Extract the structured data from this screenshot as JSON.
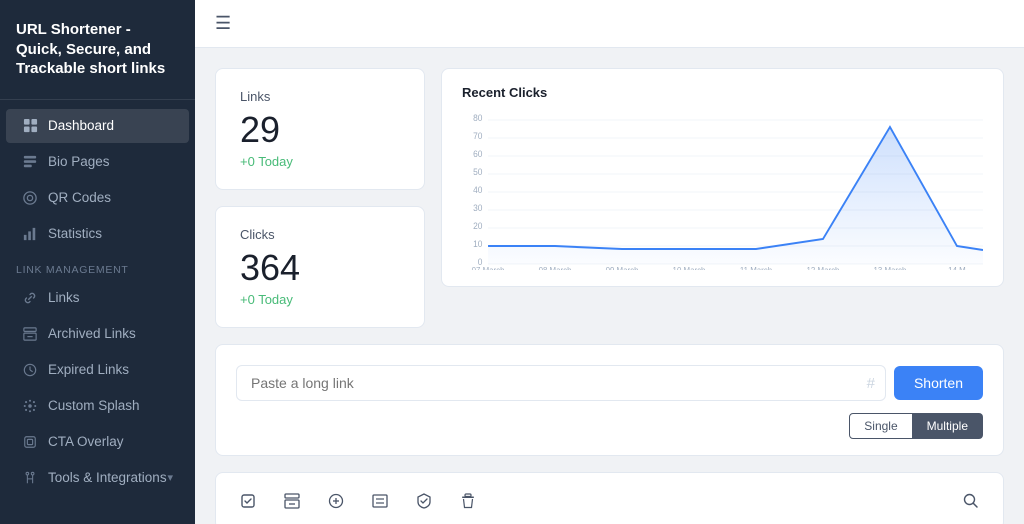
{
  "sidebar": {
    "logo": "URL Shortener - Quick, Secure, and Trackable short links",
    "nav": [
      {
        "id": "dashboard",
        "label": "Dashboard",
        "icon": "⊞",
        "active": true
      },
      {
        "id": "bio-pages",
        "label": "Bio Pages",
        "icon": "▤",
        "active": false
      },
      {
        "id": "qr-codes",
        "label": "QR Codes",
        "icon": "◎",
        "active": false
      },
      {
        "id": "statistics",
        "label": "Statistics",
        "icon": "📊",
        "active": false
      }
    ],
    "section_label": "Link Management",
    "link_items": [
      {
        "id": "links",
        "label": "Links",
        "icon": "🔗"
      },
      {
        "id": "archived-links",
        "label": "Archived Links",
        "icon": "🗂"
      },
      {
        "id": "expired-links",
        "label": "Expired Links",
        "icon": "⏱"
      },
      {
        "id": "custom-splash",
        "label": "Custom Splash",
        "icon": "✦"
      },
      {
        "id": "cta-overlay",
        "label": "CTA Overlay",
        "icon": "◈"
      },
      {
        "id": "tools-integrations",
        "label": "Tools & Integrations",
        "icon": "⚙",
        "has_chevron": true
      }
    ]
  },
  "topbar": {
    "menu_icon": "☰"
  },
  "stats": {
    "links": {
      "label": "Links",
      "value": "29",
      "today": "+0 Today"
    },
    "clicks": {
      "label": "Clicks",
      "value": "364",
      "today": "+0 Today"
    }
  },
  "chart": {
    "title": "Recent Clicks",
    "labels": [
      "07 March",
      "08 March",
      "09 March",
      "10 March",
      "11 March",
      "12 March",
      "13 March",
      "14 M"
    ],
    "y_labels": [
      "0",
      "10",
      "20",
      "30",
      "40",
      "50",
      "60",
      "70",
      "80"
    ]
  },
  "shorten": {
    "placeholder": "Paste a long link",
    "button_label": "Shorten",
    "toggle_single": "Single",
    "toggle_multiple": "Multiple"
  },
  "toolbar": {
    "icons": [
      "✓",
      "⊞",
      "⊕",
      "▤",
      "✓",
      "🗑"
    ]
  }
}
